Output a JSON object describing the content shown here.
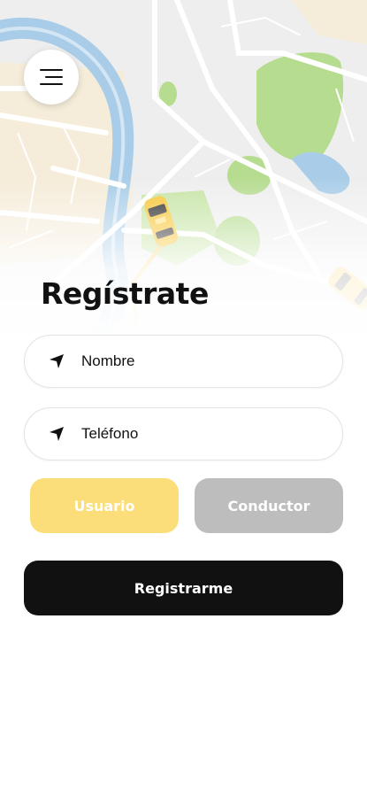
{
  "header": {
    "menu_icon": "menu-lines-icon"
  },
  "page": {
    "title": "Regístrate"
  },
  "form": {
    "name_placeholder": "Nombre",
    "phone_placeholder": "Teléfono",
    "field_icon": "navigation-arrow-icon"
  },
  "roles": {
    "user_label": "Usuario",
    "driver_label": "Conductor",
    "selected": "Usuario"
  },
  "actions": {
    "submit_label": "Registrarme"
  },
  "colors": {
    "accent": "#fbde7a",
    "inactive": "#bdbdbd",
    "primary_button": "#111111",
    "map_water": "#a7cbe6",
    "map_park": "#b5dc8f",
    "taxi": "#f6c533"
  }
}
